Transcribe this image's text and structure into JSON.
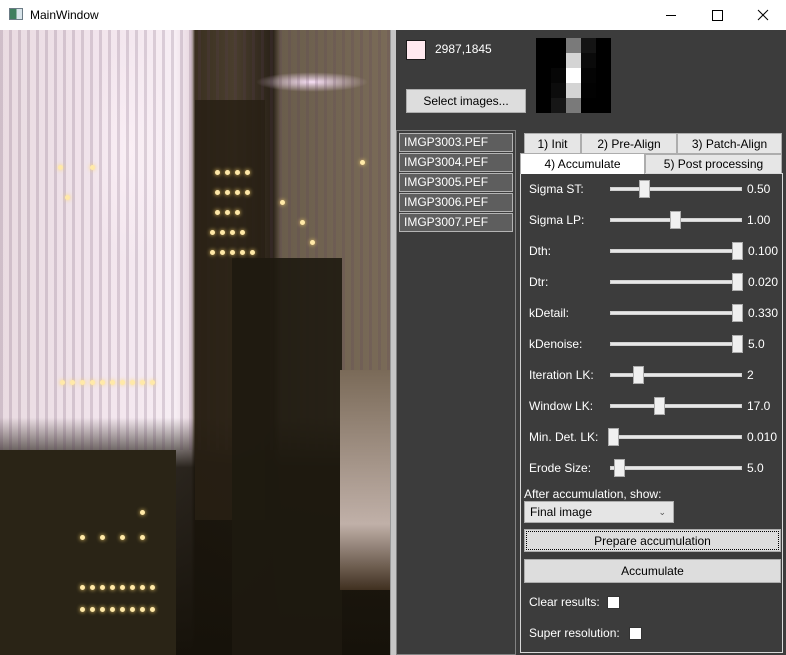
{
  "window": {
    "title": "MainWindow",
    "controls": {
      "minimize": "minimize",
      "maximize": "maximize",
      "close": "close"
    }
  },
  "photo": {
    "description": "Night city skyline preview (skyscrapers with lit windows)"
  },
  "pixel_info": {
    "swatch_color": "#ffe9ef",
    "coordinates": "2987,1845"
  },
  "kernel_preview": {
    "rows": 5,
    "cols": 5,
    "cells": [
      [
        "#000000",
        "#000000",
        "#7a7a7a",
        "#141414",
        "#000000"
      ],
      [
        "#000000",
        "#000000",
        "#d4d4d4",
        "#0a0a0a",
        "#000000"
      ],
      [
        "#000000",
        "#060606",
        "#ffffff",
        "#040404",
        "#000000"
      ],
      [
        "#000000",
        "#0c0c0c",
        "#d4d4d4",
        "#020202",
        "#000000"
      ],
      [
        "#000000",
        "#161616",
        "#7a7a7a",
        "#000000",
        "#000000"
      ]
    ]
  },
  "select_button": {
    "label": "Select images..."
  },
  "files": [
    "IMGP3003.PEF",
    "IMGP3004.PEF",
    "IMGP3005.PEF",
    "IMGP3006.PEF",
    "IMGP3007.PEF"
  ],
  "tabs": {
    "row1": [
      {
        "label": "1) Init"
      },
      {
        "label": "2) Pre-Align"
      },
      {
        "label": "3) Patch-Align"
      }
    ],
    "row2": [
      {
        "label": "4) Accumulate",
        "active": true
      },
      {
        "label": "5) Post processing"
      }
    ]
  },
  "sliders": [
    {
      "label": "Sigma ST:",
      "value": "0.50",
      "fraction": 0.25
    },
    {
      "label": "Sigma LP:",
      "value": "1.00",
      "fraction": 0.5
    },
    {
      "label": "Dth:",
      "value": "0.100",
      "fraction": 1.0
    },
    {
      "label": "Dtr:",
      "value": "0.020",
      "fraction": 1.0
    },
    {
      "label": "kDetail:",
      "value": "0.330",
      "fraction": 1.0
    },
    {
      "label": "kDenoise:",
      "value": "5.0",
      "fraction": 1.0
    },
    {
      "label": "Iteration LK:",
      "value": "2",
      "fraction": 0.2
    },
    {
      "label": "Window LK:",
      "value": "17.0",
      "fraction": 0.37
    },
    {
      "label": "Min. Det. LK:",
      "value": "0.010",
      "fraction": 0.0
    },
    {
      "label": "Erode Size:",
      "value": "5.0",
      "fraction": 0.05
    }
  ],
  "after_accumulation": {
    "label": "After accumulation, show:",
    "selected": "Final image"
  },
  "buttons": {
    "prepare": "Prepare accumulation",
    "accumulate": "Accumulate"
  },
  "checkboxes": [
    {
      "label": "Clear results:",
      "checked": false
    },
    {
      "label": "Super resolution:",
      "checked": false
    }
  ]
}
